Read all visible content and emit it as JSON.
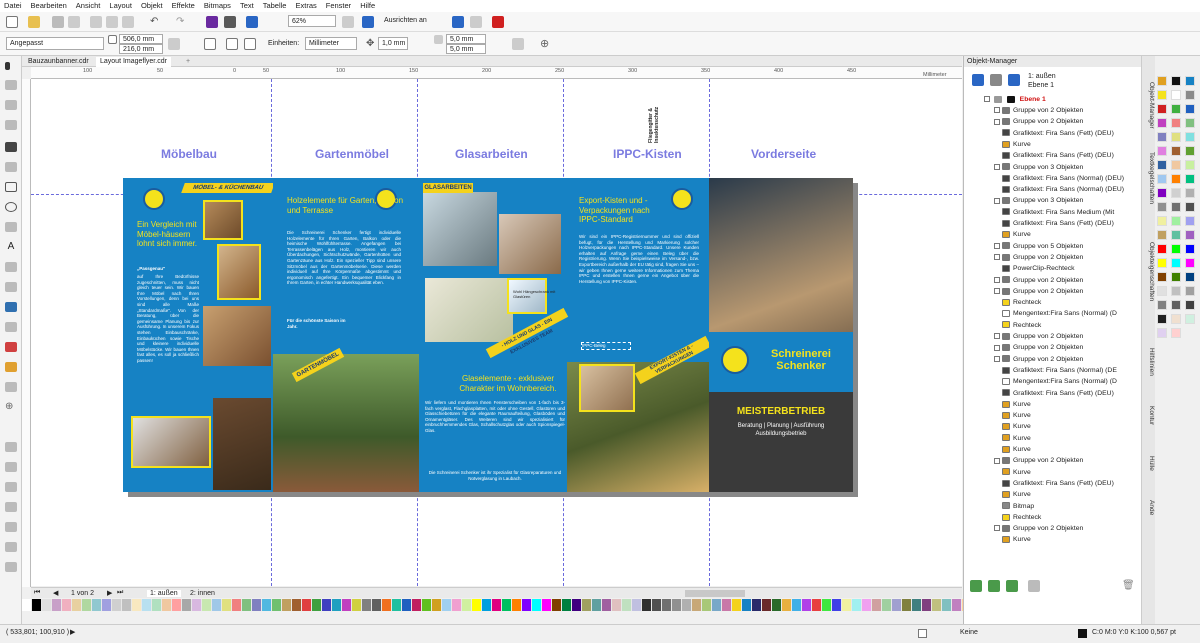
{
  "menu": [
    "Datei",
    "Bearbeiten",
    "Ansicht",
    "Layout",
    "Objekt",
    "Effekte",
    "Bitmaps",
    "Text",
    "Tabelle",
    "Extras",
    "Fenster",
    "Hilfe"
  ],
  "toolbar": {
    "zoom": "62%",
    "align": "Ausrichten an"
  },
  "propbar": {
    "preset": "Angepasst",
    "width": "506,0 mm",
    "height": "216,0 mm",
    "units_label": "Einheiten:",
    "units": "Millimeter",
    "nudge": "1,0 mm",
    "dup_x": "5,0 mm",
    "dup_y": "5,0 mm"
  },
  "doc_tabs": [
    "Bauzaunbanner.cdr",
    "Layout Imageflyer.cdr"
  ],
  "ruler": {
    "ticks": [
      "100",
      "50",
      "0",
      "50",
      "100",
      "150",
      "200",
      "250",
      "300",
      "350",
      "400",
      "450"
    ],
    "unit": "Millimeter"
  },
  "panels": {
    "titles": [
      "Möbelbau",
      "Gartenmöbel",
      "Glasarbeiten",
      "IPPC-Kisten",
      "Vorderseite"
    ],
    "vertical_note": "Fliegengitter & Insektenschutz"
  },
  "flyer": {
    "p1": {
      "banner": "MÖBEL- & KÜCHENBAU",
      "headline": "Ein Vergleich mit Möbel-häusern lohnt sich immer.",
      "quote": "„Passgenau\"",
      "body": "auf Ihre Bedürfnisse zugeschnitten, muss nicht gleich teuer sein. Wir bauen Ihre Möbel nach Ihren Vorstellungen, denn bei uns sind alle Maße „Standardmaße\". Von der Beratung, über die gemeinsame Planung bis zur Ausführung. In unserem Fokus stehen Einbauschränke, Einbauküchen sowie Tische und kleinere individuelle Möbelstücke. Wir bauen Ihnen fast alles, es soll ja schließlich passen!"
    },
    "p2": {
      "headline": "Holzelemente für Garten, Balkon und Terrasse",
      "body": "Die Schreinerei Schenker fertigt individuelle Holzelemente für Ihren Garten, Balkon oder die heimische Wohlfühlterrasse. Angefangen bei Terrassenbelägen aus Holz, montieren wir auch Überdachungen, Sichtschutzwände, Gartenhütten und Gartenzäune aus Holz. Ein spezieller Tipp sind unsere Sitzmöbel aus der Gartenmöbelserie. Diese werden individuell auf Ihre Körpermaße abgestimmt und ergonomisch angefertigt. Ein bequemer Blickfang in Ihrem Garten, in echter Handwerksqualität eben.",
      "cta": "Für die schönste Saison im Jahr.",
      "banner": "GARTENMÖBEL"
    },
    "p3": {
      "banner": "GLASARBEITEN",
      "ribbon": "- HOLZ UND GLAS - EIN EXKLUSIVES TEAM",
      "caption": "Wohl Hängeschrank mit Glastüren",
      "headline": "Glaselemente - exklusiver Charakter im Wohnbereich.",
      "body": "Wir liefern und montieren Ihnen Fensterscheiben von 1-fach bis 3-fach verglast, Flachglasplatten, mit oder ohne Gestell, Glastüren und Glasschiebetüren für die elegante Raumaufteilung, Glasböden und Ornamentgläser. Des Weiteren sind wir spezialisiert für einbruchhemmendes Glas, Schallschutzglas oder auch Spionspiegel-Glas.",
      "footer": "Die Schreinerei Schenker ist ihr Spezialist für Glasreparaturen und Notverglasung in Laubach."
    },
    "p4": {
      "headline": "Export-Kisten und -Verpackungen nach IPPC-Standard",
      "body": "Wir sind ein IPPC-Registriernummer und sind offiziell befugt, für die Herstellung und Markierung solcher Holzverpackungen nach IPPC-Standard. Unsere Kunden erhalten auf Anfrage gerne einen Beleg über die Registrierung. Wenn Sie beispielsweise im Versand-, bzw. Exportbereich außerhalb der EU tätig sind, fragen Sie uns – wir geben Ihnen gerne weitere Informationen zum Thema IPPC und erstellen Ihnen gerne ein Angebot über die Herstellung von IPPC-Kisten.",
      "stamp": "IPPC-Beleg",
      "ribbon": "EXPORT-KISTEN & -VERPACKUNGEN"
    },
    "p5": {
      "name": "Schreinerei Schenker",
      "tagline": "MEISTERBETRIEB",
      "services": "Beratung | Planung | Ausführung Ausbildungsbetrieb"
    }
  },
  "page_nav": {
    "label": "1 von 2",
    "pages": [
      "1: außen",
      "2: innen"
    ]
  },
  "status": {
    "coords": "( 533,801; 100,910 )",
    "fill": "Keine",
    "outline": "C:0 M:0 Y:0 K:100  0,567 pt"
  },
  "obj_manager": {
    "title": "Objekt-Manager",
    "page_label": "1: außen",
    "layer_label": "Ebene 1",
    "root": "Ebene 1",
    "rows": [
      "Gruppe von 2 Objekten",
      "Gruppe von 2 Objekten",
      "Grafiktext: Fira Sans (Fett) (DEU)",
      "Kurve",
      "Grafiktext: Fira Sans (Fett) (DEU)",
      "Gruppe von 3 Objekten",
      "Grafiktext: Fira Sans (Normal) (DEU)",
      "Grafiktext: Fira Sans (Normal) (DEU)",
      "Gruppe von 3 Objekten",
      "Grafiktext: Fira Sans Medium (Mit",
      "Grafiktext: Fira Sans (Fett) (DEU)",
      "Kurve",
      "Gruppe von 5 Objekten",
      "Gruppe von 2 Objekten",
      "PowerClip-Rechteck",
      "Gruppe von 2 Objekten",
      "Gruppe von 2 Objekten",
      "Rechteck",
      "Mengentext:Fira Sans (Normal) (D",
      "Rechteck",
      "Gruppe von 2 Objekten",
      "Gruppe von 2 Objekten",
      "Gruppe von 2 Objekten",
      "Grafiktext: Fira Sans (Normal) (DE",
      "Mengentext:Fira Sans (Normal) (D",
      "Grafiktext: Fira Sans (Fett) (DEU)",
      "Kurve",
      "Kurve",
      "Kurve",
      "Kurve",
      "Kurve",
      "Gruppe von 2 Objekten",
      "Kurve",
      "Grafiktext: Fira Sans (Fett) (DEU)",
      "Kurve",
      "Bitmap",
      "Rechteck",
      "Gruppe von 2 Objekten",
      "Kurve"
    ]
  },
  "side_tabs": [
    "Objekt-Manager",
    "Textkegelschaften",
    "Objekteigenschaften",
    "Hilfslinien",
    "Kontur",
    "Hülle",
    "Ände"
  ],
  "colors": {
    "accent": "#1682c4",
    "yellow": "#f4e21c",
    "guide": "#6a6adc",
    "layer_red": "#d01010"
  }
}
